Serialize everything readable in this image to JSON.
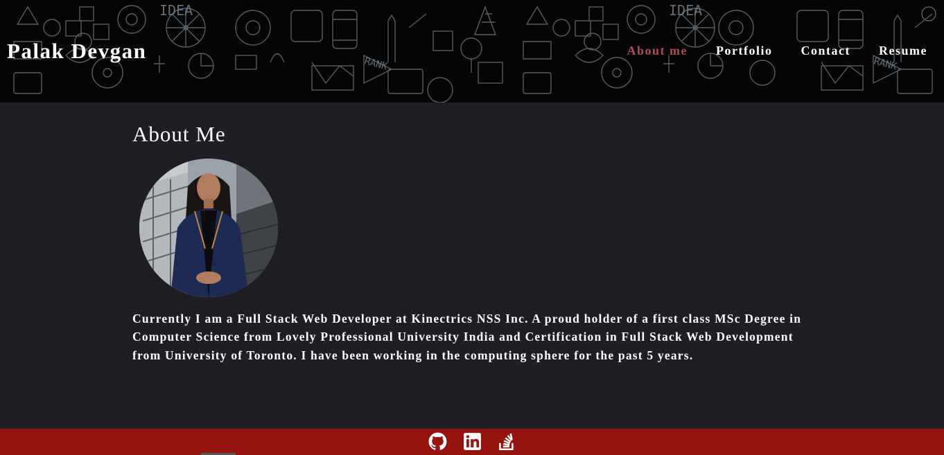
{
  "header": {
    "brand": "Palak Devgan",
    "doodle_words": [
      "IDEA",
      "RANK",
      "IDEA",
      "RANK"
    ],
    "nav": [
      {
        "label": "About me",
        "active": true
      },
      {
        "label": "Portfolio",
        "active": false
      },
      {
        "label": "Contact",
        "active": false
      },
      {
        "label": "Resume",
        "active": false
      }
    ]
  },
  "main": {
    "title": "About Me",
    "bio": "Currently I am a Full Stack Web Developer at Kinectrics NSS Inc. A proud holder of a first class MSc Degree in Computer Science from Lovely Professional University India and Certification in Full Stack Web Development from University of Toronto. I have been working in the computing sphere for the past 5 years."
  },
  "footer": {
    "icons": [
      "github-icon",
      "linkedin-icon",
      "stack-overflow-icon"
    ]
  },
  "colors": {
    "header_bg": "#050505",
    "page_bg": "#1f1e24",
    "footer_bg": "#951410",
    "nav_active": "#b04c57",
    "text": "#ffffff"
  }
}
